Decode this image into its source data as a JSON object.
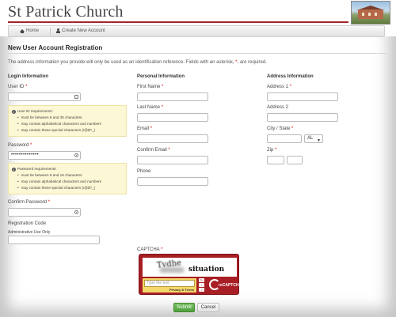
{
  "header": {
    "site_title": "St Patrick Church",
    "nav": [
      {
        "label": "Home",
        "icon": "home-icon"
      },
      {
        "label": "Create New Account",
        "icon": "user-icon"
      }
    ]
  },
  "page": {
    "title": "New User Account Registration",
    "intro_before": "The address information you provide will only be used as an identification reference. Fields with an asterisk, ",
    "intro_asterisk": "*",
    "intro_after": ", are required."
  },
  "login": {
    "heading": "Login Information",
    "user_id_label": "User ID",
    "user_id_value": "",
    "userid_note": {
      "head": "User ID requirements:",
      "items": [
        "must be between 8 and 35 characters",
        "may contain alphabetical characters and numbers",
        "may contain these special characters (!@$?_)"
      ]
    },
    "password_label": "Password",
    "password_value": "••••••••••••••",
    "password_note": {
      "head": "Password requirements:",
      "items": [
        "must be between 8 and 16 characters",
        "may contain alphabetical characters and numbers",
        "may contain these special characters (!@$?_)"
      ]
    },
    "confirm_password_label": "Confirm Password",
    "confirm_password_value": "",
    "registration_code_label": "Registration Code",
    "admin_only_label": "Administrative Use Only",
    "registration_code_value": ""
  },
  "personal": {
    "heading": "Personal Information",
    "first_name_label": "First Name",
    "last_name_label": "Last Name",
    "email_label": "Email",
    "confirm_email_label": "Confirm Email",
    "phone_label": "Phone"
  },
  "address": {
    "heading": "Address Information",
    "address1_label": "Address 1",
    "address2_label": "Address 2",
    "city_state_label": "City / State",
    "state_value": "AL",
    "zip_label": "Zip"
  },
  "captcha": {
    "label": "CAPTCHA",
    "word1": "Tvdhe",
    "word2": "situation",
    "input_placeholder": "Type the text",
    "privacy_terms": "Privacy & Terms",
    "logo_text": "reCAPTCHA"
  },
  "required_mark": "*",
  "actions": {
    "submit_label": "Submit",
    "cancel_label": "Cancel"
  }
}
